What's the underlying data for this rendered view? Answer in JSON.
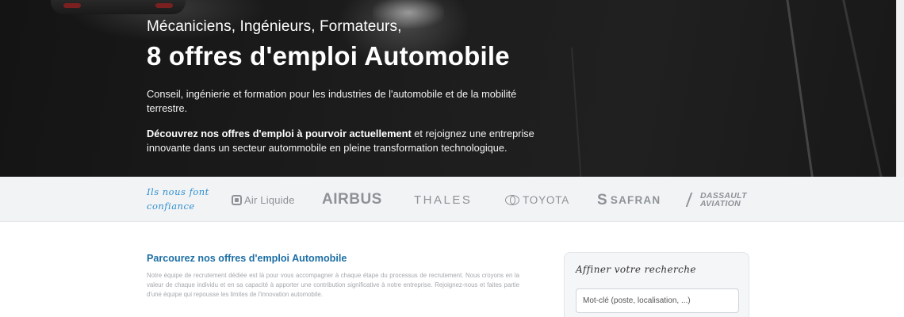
{
  "hero": {
    "subtitle": "Mécaniciens, Ingénieurs, Formateurs,",
    "title": "8 offres d'emploi Automobile",
    "description": "Conseil, ingénierie et formation pour les industries de l'automobile et de la mobilité terrestre.",
    "cta_bold": "Découvrez nos offres d'emploi à pourvoir actuellement",
    "cta_rest": " et rejoignez une entreprise innovante dans un secteur autommobile en pleine transformation technologique."
  },
  "trust_bar": {
    "label": "Ils nous font confiance",
    "logos": {
      "air_liquide": "Air Liquide",
      "airbus": "AIRBUS",
      "thales": "THALES",
      "toyota": "TOYOTA",
      "safran": "SAFRAN",
      "dassault_line1": "DASSAULT",
      "dassault_line2": "AVIATION"
    }
  },
  "main": {
    "section_title": "Parcourez nos offres d'emploi Automobile",
    "section_body": "Notre équipe de recrutement dédiée est là pour vous accompagner à chaque étape du processus de recrutement. Nous croyons en la valeur de chaque individu et en sa capacité à apporter une contribution significative à notre entreprise. Rejoignez-nous et faites partie d'une équipe qui repousse les limites de l'innovation automobile."
  },
  "sidebar": {
    "filter_title": "Affiner votre recherche",
    "search_placeholder": "Mot-clé (poste, localisation, ...)"
  },
  "colors": {
    "link_blue": "#1c6ea4",
    "script_blue": "#2e8fcf",
    "logo_gray": "#8e9296"
  }
}
